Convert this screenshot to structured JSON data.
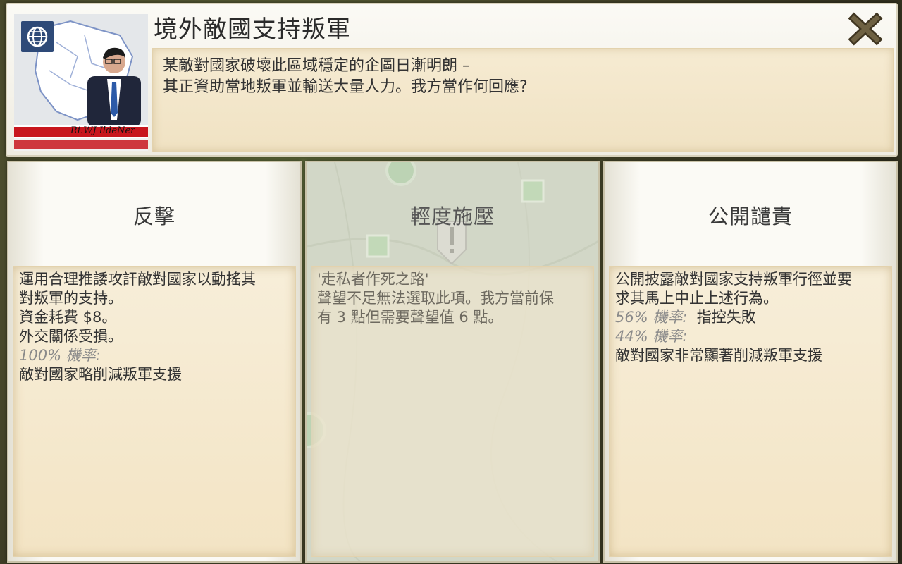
{
  "event": {
    "title": "境外敵國支持叛軍",
    "description": [
      "某敵對國家破壞此區域穩定的企圖日漸明朗 –",
      "其正資助當地叛軍並輸送大量人力。我方當作何回應?"
    ]
  },
  "portrait": {
    "icon": "globe-icon",
    "ticker_text": "Ri.WJ IldeNer"
  },
  "close": {
    "icon": "close-icon"
  },
  "options": [
    {
      "title": "反擊",
      "lines": [
        "運用合理推諉攻訐敵對國家以動搖其",
        "對叛軍的支持。",
        "資金耗費 $8。",
        "外交關係受損。"
      ],
      "outcomes": [
        {
          "probability": "100% 機率:",
          "result": "敵對國家略削減叛軍支援"
        }
      ]
    },
    {
      "title": "輕度施壓",
      "lines": [
        "'走私者作死之路'",
        "聲望不足無法選取此項。我方當前保",
        "有 3 點但需要聲望值 6 點。"
      ],
      "disabled": true
    },
    {
      "title": "公開譴責",
      "lines": [
        "公開披露敵對國家支持叛軍行徑並要",
        "求其馬上中止上述行為。"
      ],
      "outcomes": [
        {
          "probability": "56% 機率:",
          "result": "指控失敗"
        },
        {
          "probability": "44% 機率:",
          "result": "敵對國家非常顯著削減叛軍支援"
        }
      ]
    }
  ],
  "colors": {
    "panel": "#fbfaf5",
    "text_box": "#f3e4c4",
    "close_icon": "#5a4e32",
    "ticker_red": "#c8161d"
  }
}
